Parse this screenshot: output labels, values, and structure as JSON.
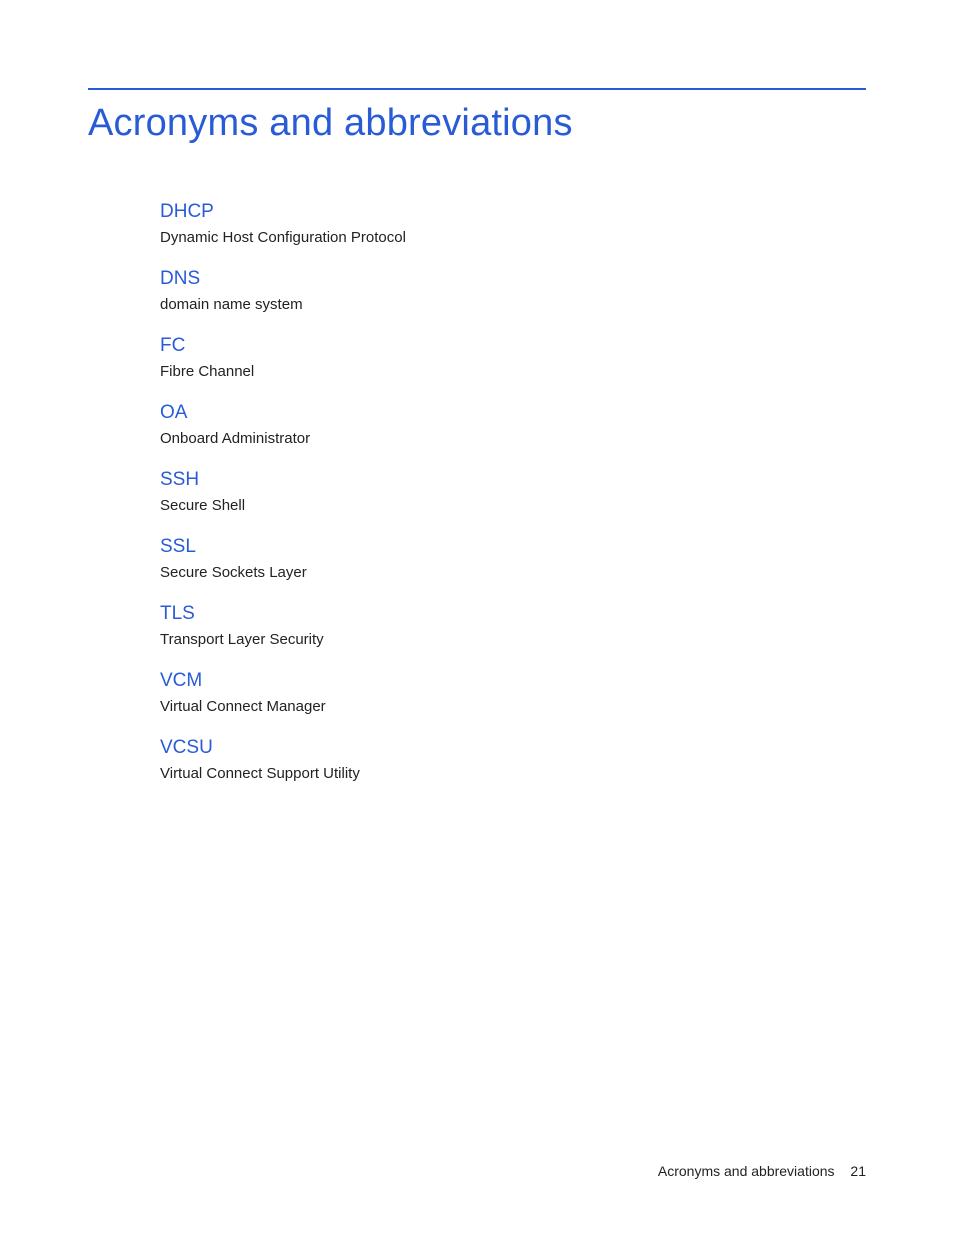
{
  "page": {
    "title": "Acronyms and abbreviations",
    "footer_label": "Acronyms and abbreviations",
    "page_number": "21"
  },
  "entries": [
    {
      "term": "DHCP",
      "def": "Dynamic Host Configuration Protocol"
    },
    {
      "term": "DNS",
      "def": "domain name system"
    },
    {
      "term": "FC",
      "def": "Fibre Channel"
    },
    {
      "term": "OA",
      "def": "Onboard Administrator"
    },
    {
      "term": "SSH",
      "def": "Secure Shell"
    },
    {
      "term": "SSL",
      "def": "Secure Sockets Layer"
    },
    {
      "term": "TLS",
      "def": "Transport Layer Security"
    },
    {
      "term": "VCM",
      "def": "Virtual Connect Manager"
    },
    {
      "term": "VCSU",
      "def": "Virtual Connect Support Utility"
    }
  ]
}
